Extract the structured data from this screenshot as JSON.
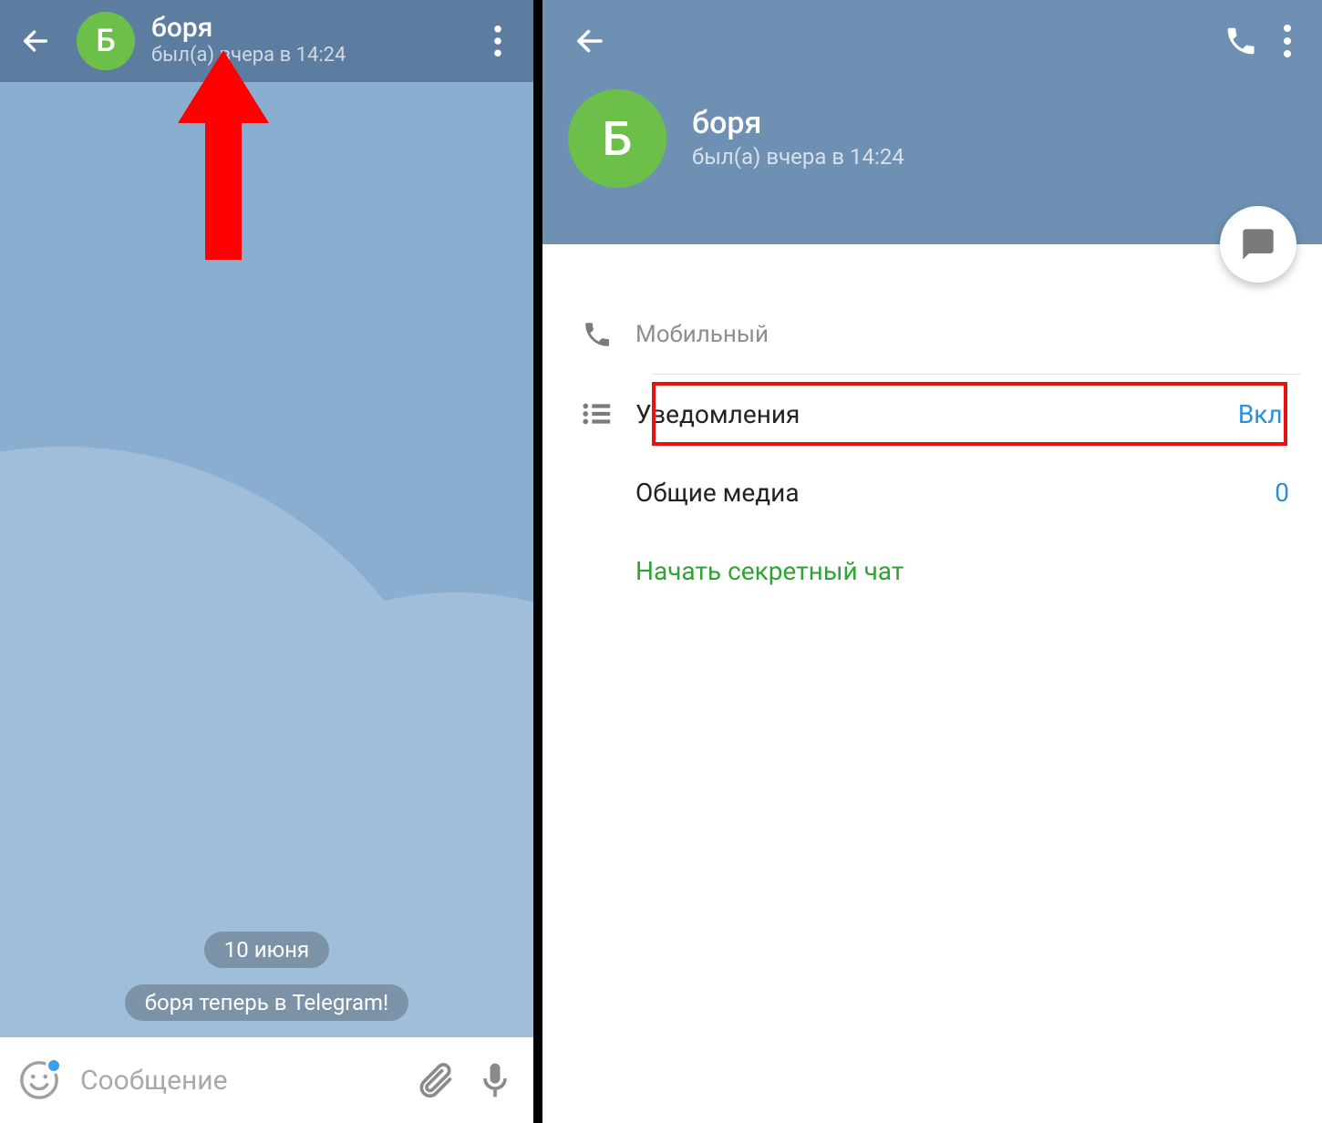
{
  "left": {
    "avatar_letter": "Б",
    "title": "боря",
    "subtitle": "был(а) вчера в 14:24",
    "date_bubble": "10 июня",
    "service_msg": "боря теперь в Telegram!",
    "input_placeholder": "Сообщение"
  },
  "right": {
    "avatar_letter": "Б",
    "title": "боря",
    "subtitle": "был(а) вчера в 14:24",
    "mobile_label": "Мобильный",
    "notifications_label": "Уведомления",
    "notifications_value": "Вкл.",
    "shared_media_label": "Общие медиа",
    "shared_media_value": "0",
    "secret_chat_label": "Начать секретный чат"
  }
}
